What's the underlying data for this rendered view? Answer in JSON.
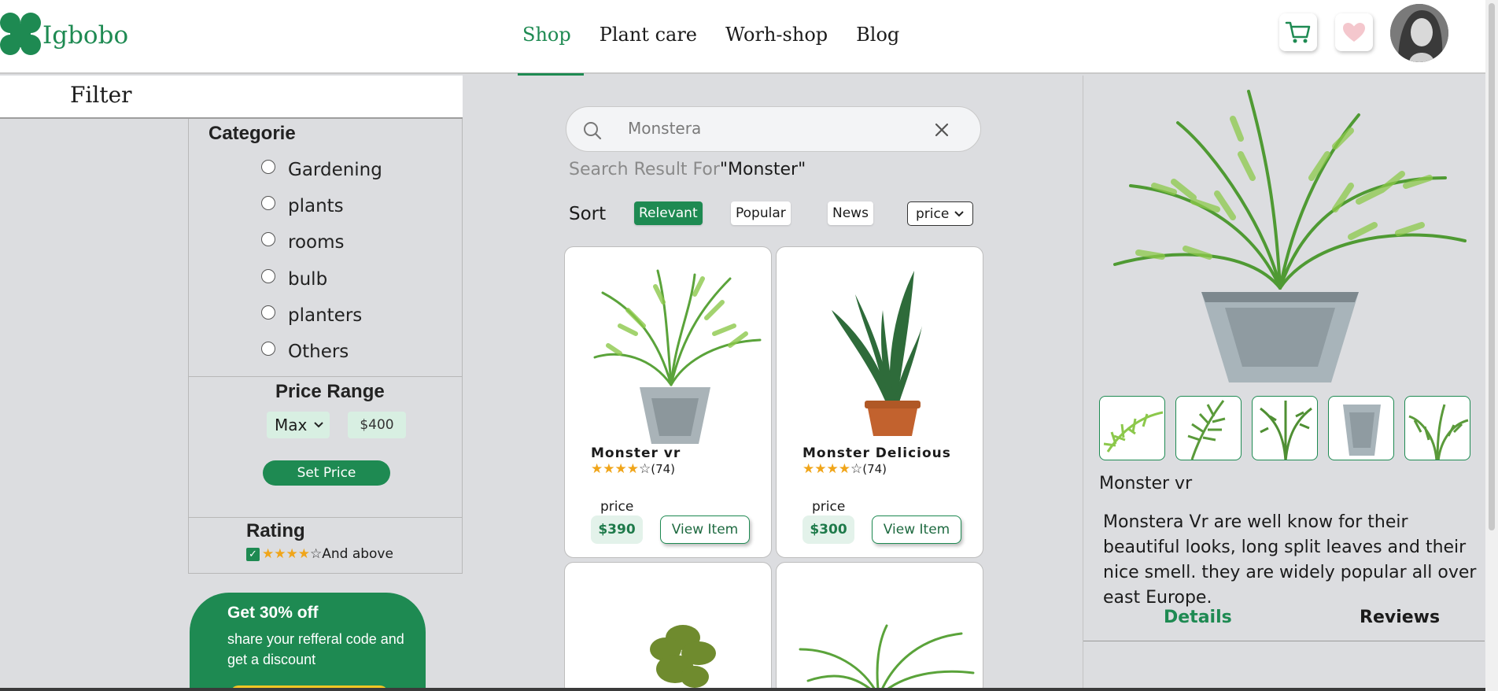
{
  "brand": {
    "name": "Igbobo",
    "color": "#1e8a52"
  },
  "nav": {
    "items": [
      {
        "label": "Shop",
        "active": true
      },
      {
        "label": "Plant care",
        "active": false
      },
      {
        "label": "Worh-shop",
        "active": false
      },
      {
        "label": "Blog",
        "active": false
      }
    ],
    "icons": [
      "cart-icon",
      "heart-icon",
      "avatar"
    ]
  },
  "filter": {
    "title": "Filter",
    "category": {
      "title": "Categorie",
      "options": [
        "Gardening",
        "plants",
        "rooms",
        "bulb",
        "planters",
        "Others"
      ]
    },
    "price_range": {
      "title": "Price Range",
      "select_value": "Max",
      "value": "$400",
      "button": "Set Price"
    },
    "rating": {
      "title": "Rating",
      "checked": true,
      "stars": 4,
      "suffix": "And above"
    }
  },
  "promo": {
    "title": "Get 30% off",
    "text": "share your refferal code and get a discount"
  },
  "search": {
    "value": "Monstera",
    "result_prefix": "Search Result For",
    "result_term": "\"Monster\""
  },
  "sort": {
    "label": "Sort",
    "options": [
      "Relevant",
      "Popular",
      "News"
    ],
    "active": "Relevant",
    "select_value": "price"
  },
  "products": [
    {
      "name": "Monster vr",
      "stars": 4,
      "reviews": "(74)",
      "price_label": "price",
      "price": "$390",
      "button": "View Item"
    },
    {
      "name": "Monster Delicious",
      "stars": 4,
      "reviews": "(74)",
      "price_label": "price",
      "price": "$300",
      "button": "View Item"
    }
  ],
  "detail": {
    "name": "Monster vr",
    "description": "Monstera Vr are well know for their beautiful looks, long split leaves and their nice smell. they are widely popular all over east Europe.",
    "tabs": [
      "Details",
      "Reviews"
    ],
    "active_tab": "Details",
    "thumbnail_count": 5
  }
}
